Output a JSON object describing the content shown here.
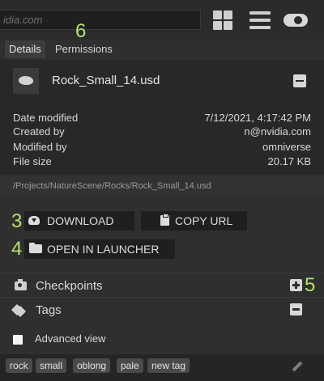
{
  "search": {
    "value": "idia.com"
  },
  "annotations": [
    "3",
    "4",
    "5",
    "6"
  ],
  "tabs": [
    {
      "label": "Details",
      "active": true
    },
    {
      "label": "Permissions",
      "active": false
    }
  ],
  "file": {
    "name": "Rock_Small_14.usd"
  },
  "properties": [
    {
      "key": "Date modified",
      "value": "7/12/2021, 4:17:42 PM"
    },
    {
      "key": "Created by",
      "value": "n@nvidia.com"
    },
    {
      "key": "Modified by",
      "value": "omniverse"
    },
    {
      "key": "File size",
      "value": "20.17 KB"
    }
  ],
  "path": "/Projects/NatureScene/Rocks/Rock_Small_14.usd",
  "actions": {
    "download_label": "DOWNLOAD",
    "copy_url_label": "COPY URL",
    "open_launcher_label": "OPEN IN LAUNCHER"
  },
  "sections": {
    "checkpoints_label": "Checkpoints",
    "tags_label": "Tags"
  },
  "advanced_view_label": "Advanced view",
  "tags": [
    "rock",
    "small",
    "oblong",
    "pale",
    "new tag"
  ],
  "colors": {
    "annotation": "#b5e36d",
    "background": "#2f2f2f",
    "button": "#1f1f1f"
  }
}
